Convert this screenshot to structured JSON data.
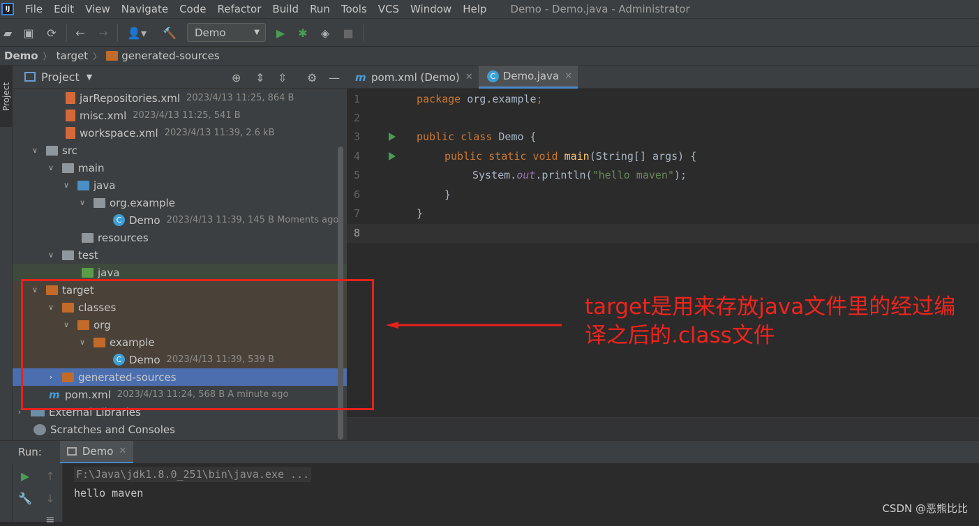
{
  "menubar": {
    "items": [
      "File",
      "Edit",
      "View",
      "Navigate",
      "Code",
      "Refactor",
      "Build",
      "Run",
      "Tools",
      "VCS",
      "Window",
      "Help"
    ],
    "window_title": "Demo - Demo.java - Administrator"
  },
  "toolbar": {
    "run_config": "Demo"
  },
  "breadcrumb": [
    "Demo",
    "target",
    "generated-sources"
  ],
  "left_strip": {
    "project_tab": "Project"
  },
  "project": {
    "header": "Project",
    "tree": [
      {
        "name": "jarRepositories.xml",
        "meta": "2023/4/13 11:25, 864 B"
      },
      {
        "name": "misc.xml",
        "meta": "2023/4/13 11:25, 541 B"
      },
      {
        "name": "workspace.xml",
        "meta": "2023/4/13 11:39, 2.6 kB"
      },
      {
        "name": "src",
        "meta": ""
      },
      {
        "name": "main",
        "meta": ""
      },
      {
        "name": "java",
        "meta": ""
      },
      {
        "name": "org.example",
        "meta": ""
      },
      {
        "name": "Demo",
        "meta": "2023/4/13 11:39, 145 B Moments ago"
      },
      {
        "name": "resources",
        "meta": ""
      },
      {
        "name": "test",
        "meta": ""
      },
      {
        "name": "java",
        "meta": ""
      },
      {
        "name": "target",
        "meta": ""
      },
      {
        "name": "classes",
        "meta": ""
      },
      {
        "name": "org",
        "meta": ""
      },
      {
        "name": "example",
        "meta": ""
      },
      {
        "name": "Demo",
        "meta": "2023/4/13 11:39, 539 B"
      },
      {
        "name": "generated-sources",
        "meta": ""
      },
      {
        "name": "pom.xml",
        "meta": "2023/4/13 11:24, 568 B A minute ago"
      },
      {
        "name": "External Libraries",
        "meta": ""
      },
      {
        "name": "Scratches and Consoles",
        "meta": ""
      }
    ]
  },
  "editor": {
    "tabs": [
      {
        "label": "pom.xml (Demo)",
        "active": false
      },
      {
        "label": "Demo.java",
        "active": true
      }
    ],
    "line_numbers": [
      "1",
      "2",
      "3",
      "4",
      "5",
      "6",
      "7",
      "8"
    ],
    "code": {
      "l1_kw": "package",
      "l1_rest": " org.example",
      "l3_kw": "public class",
      "l3_rest": " Demo {",
      "l4_kw": "public static void",
      "l4_fn": "main",
      "l4_rest": "(String[] args) {",
      "l5_a": "System.",
      "l5_out": "out",
      "l5_b": ".println(",
      "l5_str": "\"hello maven\"",
      "l5_c": ");",
      "l6": "}",
      "l7": "}"
    }
  },
  "annotation": {
    "text": "target是用来存放java文件里的经过编译之后的.class文件",
    "color": "#f0241d"
  },
  "run": {
    "label": "Run:",
    "tab": "Demo",
    "console": [
      "F:\\Java\\jdk1.8.0_251\\bin\\java.exe ...",
      "hello maven"
    ]
  },
  "watermark": "CSDN @恶熊比比"
}
